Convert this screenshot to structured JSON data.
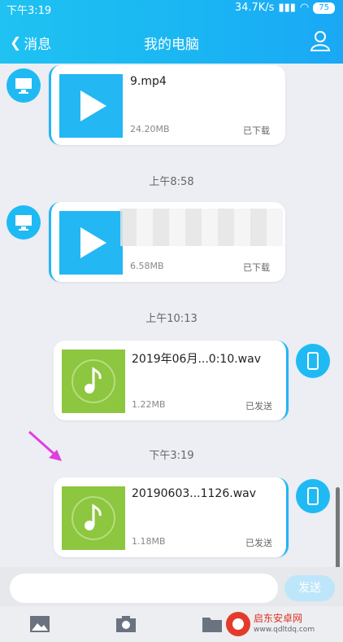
{
  "status": {
    "time": "下午3:19",
    "speed": "34.7K/s",
    "battery": "75"
  },
  "nav": {
    "back_label": "消息",
    "title": "我的电脑"
  },
  "messages": [
    {
      "name": "9.mp4",
      "size": "24.20MB",
      "status": "已下载"
    },
    {
      "name": "",
      "size": "6.58MB",
      "status": "已下载"
    },
    {
      "name": "2019年06月...0:10.wav",
      "size": "1.22MB",
      "status": "已发送"
    },
    {
      "name": "20190603...1126.wav",
      "size": "1.18MB",
      "status": "已发送"
    }
  ],
  "times": [
    "上午8:58",
    "上午10:13",
    "下午3:19"
  ],
  "input": {
    "send_label": "发送"
  },
  "watermark": {
    "name": "启东安卓网",
    "url": "www.qdltdq.com"
  }
}
